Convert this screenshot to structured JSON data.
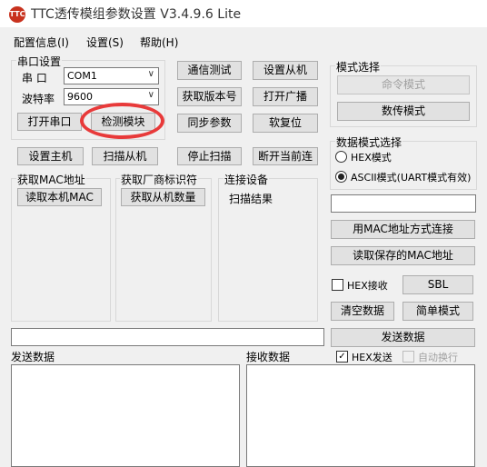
{
  "window": {
    "title": "TTC透传模组参数设置 V3.4.9.6 Lite",
    "icon": "ttc-logo-icon",
    "icon_text": "TTC"
  },
  "menu": [
    "配置信息(I)",
    "设置(S)",
    "帮助(H)"
  ],
  "serial": {
    "group_label": "串口设置",
    "port_label": "串  口",
    "port_value": "COM1",
    "baud_label": "波特率",
    "baud_value": "9600",
    "open_button": "打开串口",
    "detect_button": "检测模块"
  },
  "buttons": {
    "comm_test": "通信测试",
    "set_slave": "设置从机",
    "get_version": "获取版本号",
    "open_broadcast": "打开广播",
    "sync_params": "同步参数",
    "soft_reset": "软复位",
    "set_master": "设置主机",
    "scan_slave": "扫描从机",
    "stop_scan": "停止扫描",
    "disconnect": "断开当前连",
    "read_local_mac": "读取本机MAC",
    "get_slave_count": "获取从机数量",
    "connect_by_mac": "用MAC地址方式连接",
    "read_saved_mac": "读取保存的MAC地址",
    "sbl": "SBL",
    "clear_data": "清空数据",
    "simple_mode": "简单模式",
    "send_data": "发送数据"
  },
  "sections": {
    "get_mac": "获取MAC地址",
    "get_vendor": "获取厂商标识符",
    "connect_device": "连接设备",
    "scan_result": "扫描结果"
  },
  "mode": {
    "group_label": "模式选择",
    "command_mode": "命令模式",
    "transparent_mode": "数传模式"
  },
  "data_mode": {
    "group_label": "数据模式选择",
    "hex_option": "HEX模式",
    "ascii_option": "ASCII模式(UART模式有效)",
    "selected": "ascii"
  },
  "receive_options": {
    "hex_receive": "HEX接收",
    "hex_send": "HEX发送",
    "auto_wrap": "自动换行",
    "hex_send_checked": true
  },
  "panels": {
    "send": "发送数据",
    "receive": "接收数据"
  },
  "colors": {
    "highlight": "#e83a3a",
    "disabled_text": "#a0a0a0"
  }
}
